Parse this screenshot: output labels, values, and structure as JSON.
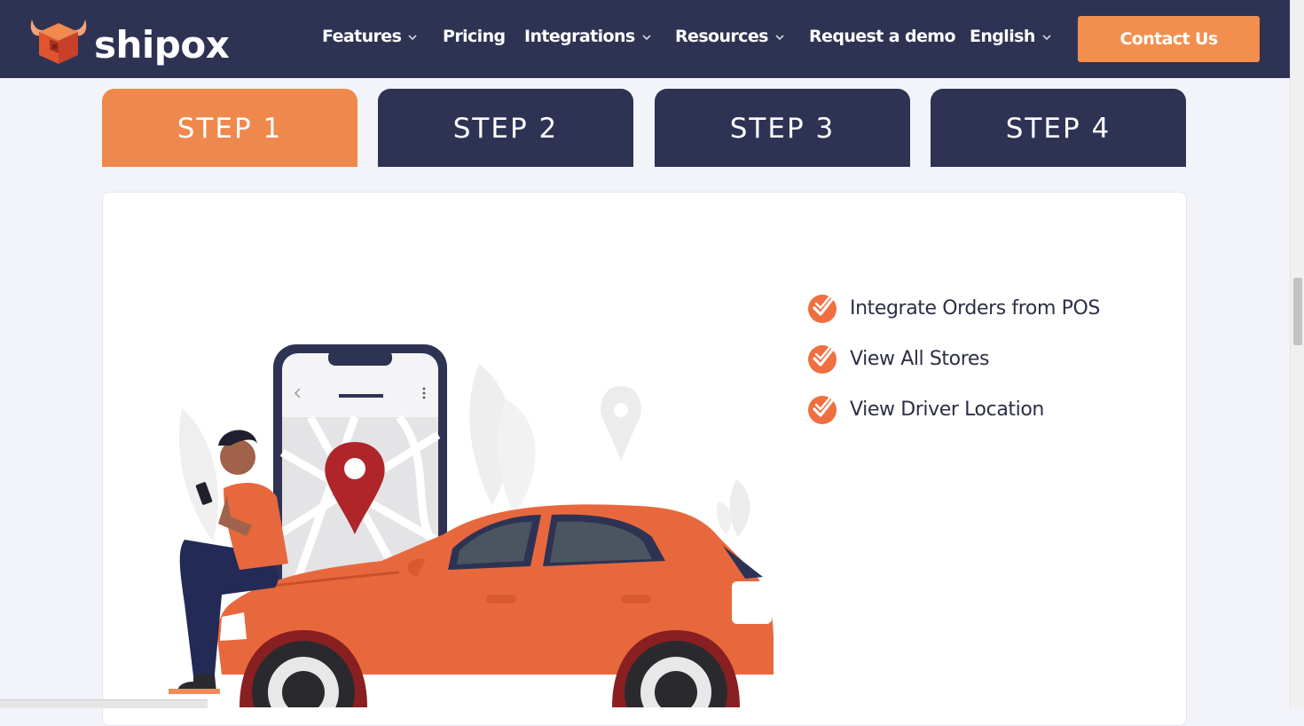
{
  "header": {
    "logo_text": "shipox",
    "nav": [
      {
        "label": "Features",
        "has_dropdown": true
      },
      {
        "label": "Pricing",
        "has_dropdown": false
      },
      {
        "label": "Integrations",
        "has_dropdown": true
      },
      {
        "label": "Resources",
        "has_dropdown": true
      },
      {
        "label": "Request a demo",
        "has_dropdown": false
      },
      {
        "label": "English",
        "has_dropdown": true
      }
    ],
    "contact_label": "Contact Us"
  },
  "tabs": [
    {
      "label": "STEP 1",
      "active": true
    },
    {
      "label": "STEP 2",
      "active": false
    },
    {
      "label": "STEP 3",
      "active": false
    },
    {
      "label": "STEP 4",
      "active": false
    }
  ],
  "features": [
    {
      "label": "Integrate Orders from POS",
      "icon": "check-badge-icon"
    },
    {
      "label": "View All Stores",
      "icon": "check-badge-icon"
    },
    {
      "label": "View Driver Location",
      "icon": "check-badge-icon"
    }
  ],
  "colors": {
    "navy": "#2e3354",
    "orange": "#ef884c",
    "button_orange": "#f28f4f",
    "car_orange": "#e8683d",
    "pin_red": "#b0252a"
  }
}
